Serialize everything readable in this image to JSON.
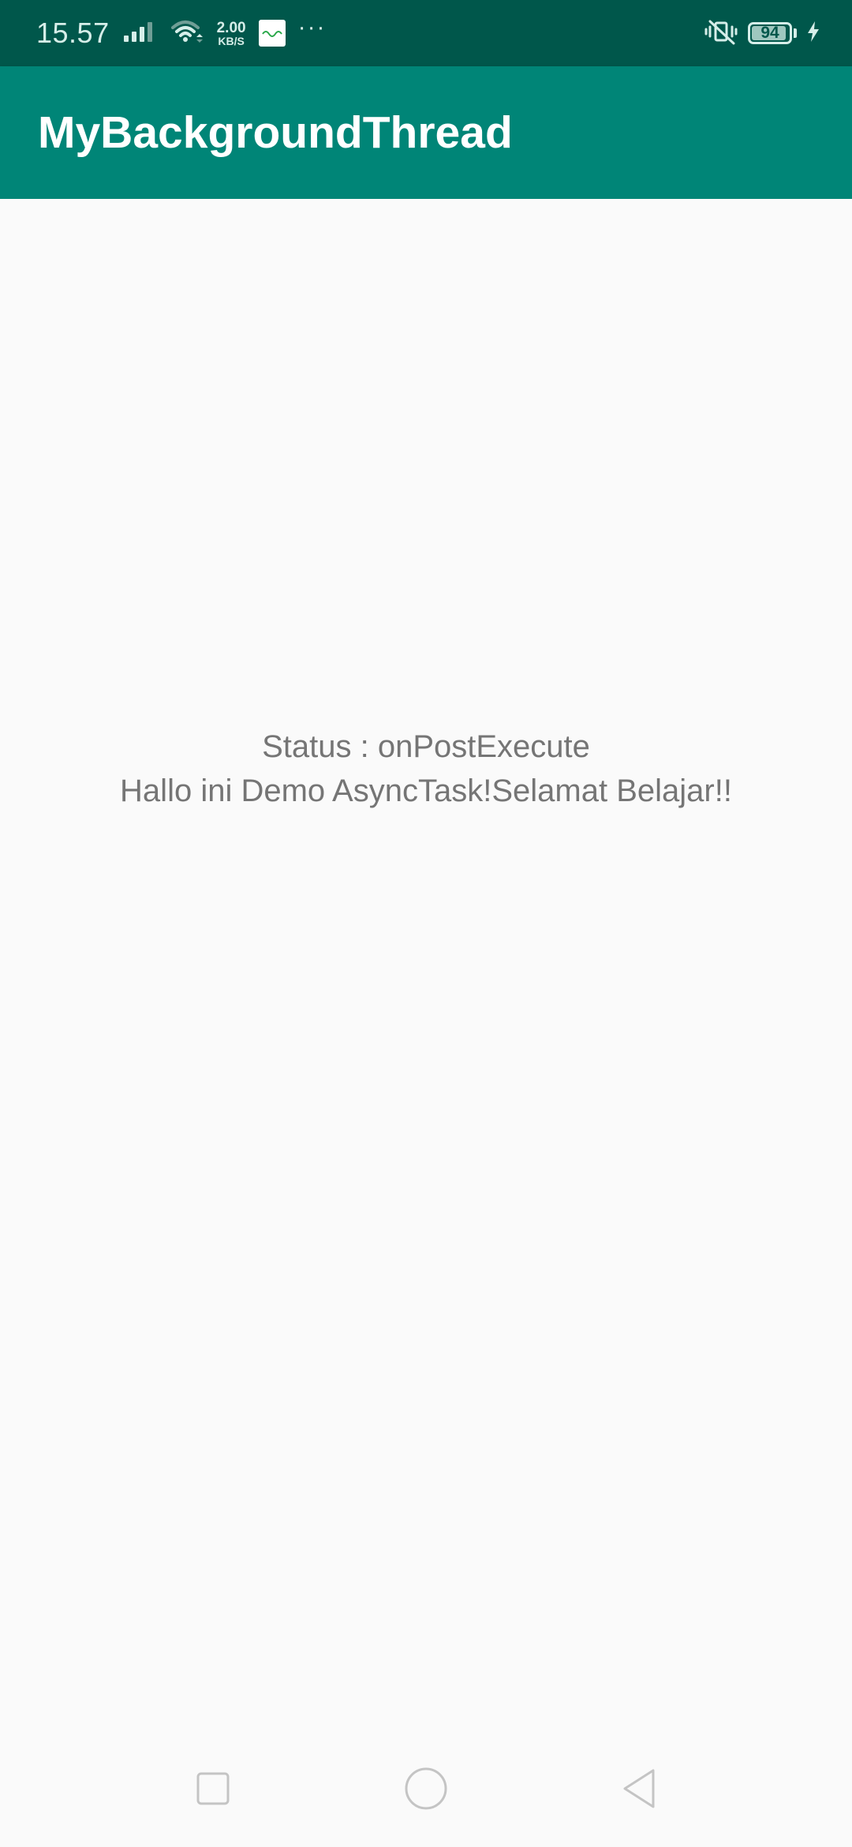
{
  "status_bar": {
    "time": "15.57",
    "net_speed_value": "2.00",
    "net_speed_unit": "KB/S",
    "more_notifications": "···",
    "battery_level": "94",
    "battery_fraction": 0.94,
    "icons": [
      "signal-icon",
      "wifi-icon",
      "app-notification-icon",
      "more-icon",
      "vibrate-icon",
      "battery-icon",
      "charging-icon"
    ],
    "background_color": "#00574b"
  },
  "app_bar": {
    "title": "MyBackgroundThread",
    "background_color": "#008577"
  },
  "main": {
    "status_line": "Status : onPostExecute",
    "message_line": "Hallo ini Demo AsyncTask!Selamat Belajar!!"
  },
  "nav_bar": {
    "buttons": [
      "recents-button",
      "home-button",
      "back-button"
    ]
  }
}
